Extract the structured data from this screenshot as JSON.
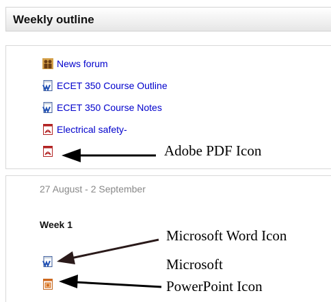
{
  "header": {
    "title": "Weekly outline"
  },
  "section_top": {
    "items": [
      {
        "label": "News forum",
        "icon": "forum-icon"
      },
      {
        "label": "ECET 350 Course Outline",
        "icon": "word-doc-icon"
      },
      {
        "label": "ECET 350 Course Notes",
        "icon": "word-doc-icon"
      },
      {
        "label": "Electrical safety-",
        "icon": "pdf-icon"
      }
    ],
    "pdf_icon_name": "pdf-icon"
  },
  "section_week": {
    "date_range": "27 August - 2 September",
    "week_title": "Week 1",
    "word_icon_name": "word-doc-icon",
    "ppt_icon_name": "powerpoint-icon"
  },
  "annotations": {
    "pdf": "Adobe PDF Icon",
    "word": "Microsoft Word Icon",
    "ppt_line1": "Microsoft",
    "ppt_line2": "PowerPoint Icon"
  },
  "colors": {
    "link": "#0000cc",
    "muted_text": "#888888",
    "pdf_red": "#b22222",
    "word_blue": "#1f4fb3",
    "ppt_orange": "#d2691e",
    "arrow_dark": "#2a1a1a"
  }
}
